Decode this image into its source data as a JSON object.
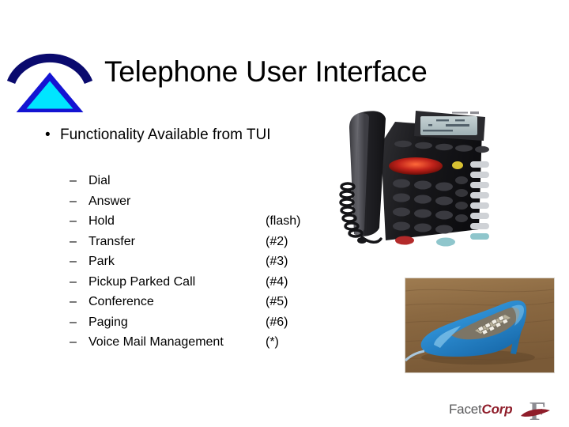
{
  "slide": {
    "title": "Telephone User Interface",
    "background_color": "#ffffff"
  },
  "logo": {
    "name": "facetcorp-arc-triangle-logo",
    "arc_color": "#0a0a6e",
    "triangle_fill": "#00e5ff",
    "triangle_stroke": "#1414d2"
  },
  "body": {
    "bullet_glyph": "•",
    "level1": {
      "text": "Functionality Available from TUI"
    },
    "dash_glyph": "–",
    "items": [
      {
        "label": "Dial",
        "code": ""
      },
      {
        "label": "Answer",
        "code": ""
      },
      {
        "label": "Hold",
        "code": "(flash)"
      },
      {
        "label": "Transfer",
        "code": "(#2)"
      },
      {
        "label": "Park",
        "code": "(#3)"
      },
      {
        "label": "Pickup Parked Call",
        "code": "(#4)"
      },
      {
        "label": "Conference",
        "code": "(#5)"
      },
      {
        "label": "Paging",
        "code": "(#6)"
      },
      {
        "label": "Voice Mail Management",
        "code": "(*)"
      }
    ]
  },
  "images": {
    "deskphone": {
      "alt": "black multi-line business desk telephone with LCD display, keypad and side feature buttons",
      "body_color": "#1a1a1c",
      "lcd_color": "#b9c6c9"
    },
    "shoephone": {
      "alt": "blue high heel shoe novelty telephone with keypad, sitting on a wooden desk",
      "shoe_color": "#2e8fd4",
      "desk_color": "#9a7247"
    }
  },
  "footer": {
    "brand_part1": "Facet",
    "brand_part2": "Corp",
    "mark_letter": "F",
    "brand_gray": "#58585a",
    "brand_red": "#8f1d2a"
  }
}
